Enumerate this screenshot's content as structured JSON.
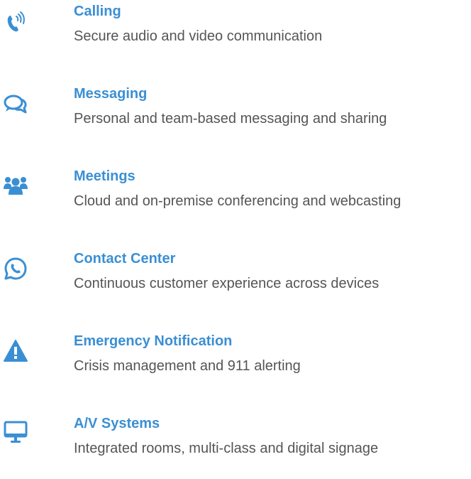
{
  "accent_color": "#3a8fd4",
  "text_color": "#555555",
  "features": [
    {
      "icon": "phone-calling-icon",
      "title": "Calling",
      "description": "Secure audio and video communication"
    },
    {
      "icon": "chat-bubbles-icon",
      "title": "Messaging",
      "description": "Personal and team-based messaging and sharing"
    },
    {
      "icon": "users-group-icon",
      "title": "Meetings",
      "description": "Cloud and on-premise conferencing and webcasting"
    },
    {
      "icon": "whatsapp-phone-icon",
      "title": "Contact Center",
      "description": "Continuous customer experience across devices"
    },
    {
      "icon": "warning-triangle-icon",
      "title": "Emergency Notification",
      "description": "Crisis management and 911 alerting"
    },
    {
      "icon": "desktop-monitor-icon",
      "title": "A/V Systems",
      "description": "Integrated rooms, multi-class and digital signage"
    }
  ]
}
